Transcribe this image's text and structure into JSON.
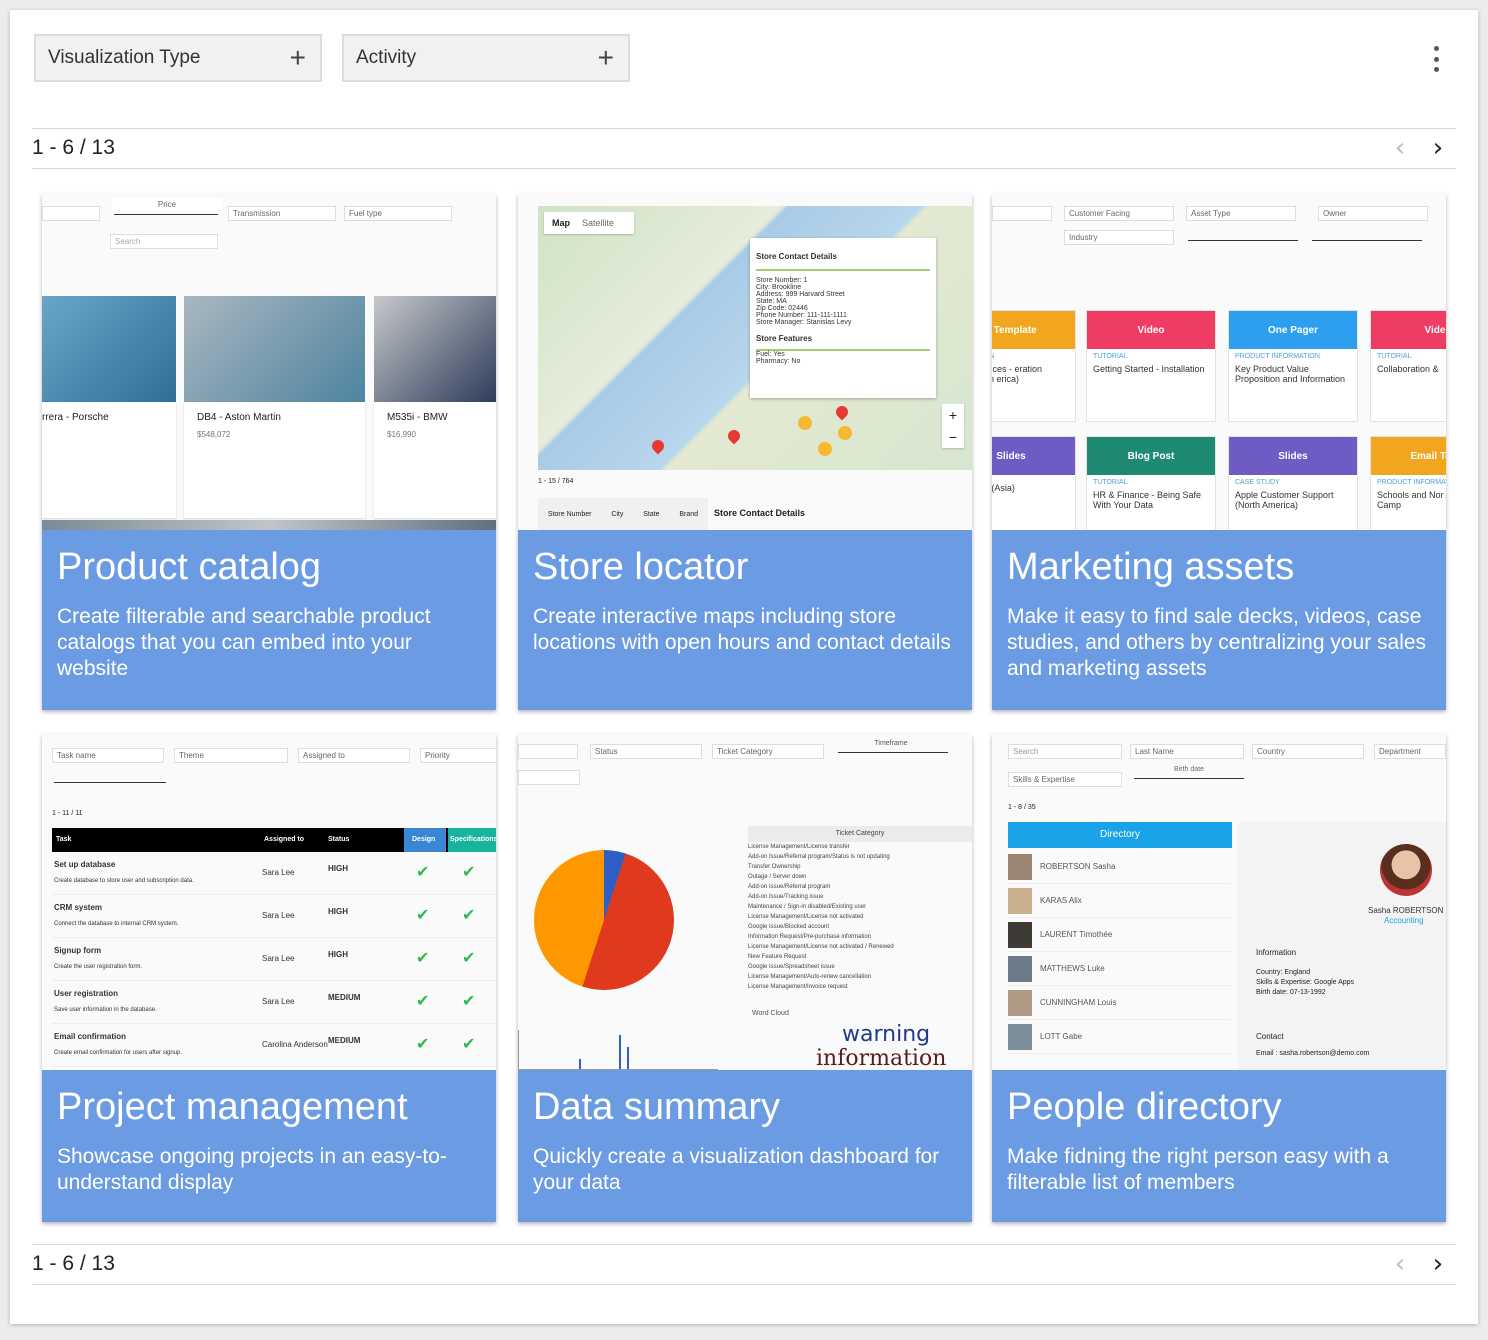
{
  "filters": [
    {
      "label": "Visualization Type",
      "icon": "plus-icon"
    },
    {
      "label": "Activity",
      "icon": "plus-icon"
    }
  ],
  "pagination": {
    "top": "1 - 6 / 13",
    "bottom": "1 - 6 / 13"
  },
  "cards": [
    {
      "title": "Product catalog",
      "description": "Create filterable and searchable product catalogs that you can embed into your website"
    },
    {
      "title": "Store locator",
      "description": "Create interactive maps including store locations with open hours and contact details"
    },
    {
      "title": "Marketing assets",
      "description": "Make it easy to find sale decks, videos, case studies, and others by centralizing your sales and marketing assets"
    },
    {
      "title": "Project management",
      "description": "Showcase ongoing projects in an easy-to-understand display"
    },
    {
      "title": "Data summary",
      "description": "Quickly create a visualization dashboard for your data"
    },
    {
      "title": "People directory",
      "description": "Make fidning the right person easy with a filterable list of members"
    }
  ],
  "thumbs": {
    "product": {
      "filters": [
        "Price",
        "Transmission",
        "Fuel type",
        "Search"
      ],
      "items": [
        {
          "name": "rrera - Porsche",
          "price": ""
        },
        {
          "name": "DB4 - Aston Martin",
          "price": "$548,072"
        },
        {
          "name": "M535i - BMW",
          "price": "$16,990"
        }
      ]
    },
    "store": {
      "tabs": [
        "Map",
        "Satellite"
      ],
      "popup_title": "Store Contact Details",
      "popup_lines": [
        "Store Number: 1",
        "City: Brookline",
        "Address: 999 Harvard Street",
        "State: MA",
        "Zip Code: 02446",
        "Phone Number: 111-111-1111",
        "Store Manager: Stanislas Levy"
      ],
      "features_title": "Store Features",
      "features": [
        "Fuel: Yes",
        "Pharmacy: No"
      ],
      "count": "1 - 15 / 764",
      "table_headers": [
        "Store Number",
        "City",
        "State",
        "Brand"
      ],
      "side_title": "Store Contact Details"
    },
    "marketing": {
      "filters": [
        "Customer Facing",
        "Asset Type",
        "Owner",
        "Industry"
      ],
      "tiles": [
        {
          "head": "il Template",
          "label": "FORMATION",
          "text": "Life Sciences - eration Campaign erica)",
          "color": "#f2a61f"
        },
        {
          "head": "Video",
          "label": "TUTORIAL",
          "text": "Getting Started - Installation",
          "color": "#ef3c63"
        },
        {
          "head": "One Pager",
          "label": "PRODUCT INFORMATION",
          "text": "Key Product Value Proposition and Information",
          "color": "#2c9fee"
        },
        {
          "head": "Vide",
          "label": "TUTORIAL",
          "text": "Collaboration &",
          "color": "#ef3c63"
        },
        {
          "head": "Slides",
          "label": "",
          "text": "les Team (Asia)",
          "color": "#6e5bc4"
        },
        {
          "head": "Blog Post",
          "label": "TUTORIAL",
          "text": "HR & Finance - Being Safe With Your Data",
          "color": "#1f8a73"
        },
        {
          "head": "Slides",
          "label": "CASE STUDY",
          "text": "Apple Customer Support (North America)",
          "color": "#6e5bc4"
        },
        {
          "head": "Email Tem",
          "label": "PRODUCT INFORMAT",
          "text": "Schools and Nor Awareness Camp",
          "color": "#f2a61f"
        }
      ]
    },
    "project": {
      "filters": [
        "Task name",
        "Theme",
        "Assigned to",
        "Priority"
      ],
      "count": "1 - 11 / 11",
      "headers": [
        "Task",
        "Assigned to",
        "Status",
        "Design",
        "Specifications"
      ],
      "rows": [
        {
          "task": "Set up database",
          "desc": "Create database to store user and subscription data.",
          "who": "Sara Lee",
          "status": "HIGH"
        },
        {
          "task": "CRM system",
          "desc": "Connect the database to internal CRM system.",
          "who": "Sara Lee",
          "status": "HIGH"
        },
        {
          "task": "Signup form",
          "desc": "Create the user registration form.",
          "who": "Sara Lee",
          "status": "HIGH"
        },
        {
          "task": "User registration",
          "desc": "Save user information in the database.",
          "who": "Sara Lee",
          "status": "MEDIUM"
        },
        {
          "task": "Email confirmation",
          "desc": "Create email confirmation for users after signup.",
          "who": "Carolina Anderson",
          "status": "MEDIUM"
        }
      ]
    },
    "data": {
      "filters": [
        "Status",
        "Ticket Category",
        "Timeframe"
      ],
      "legend_title": "Ticket Category",
      "legend": [
        "License Management/License transfer",
        "Add-on Issue/Referral program/Status is not updating",
        "Transfer Ownership",
        "Outage / Server down",
        "Add-on Issue/Referral program",
        "Add-on Issue/Tracking issue",
        "Maintenance / Sign-in disabled/Existing user",
        "License Management/License not activated",
        "Google Issue/Blocked account",
        "Information Request/Pre-purchase information",
        "License Management/License not activated / Renewed",
        "New Feature Request",
        "Google Issue/Spreadsheet issue",
        "License Management/Auto-renew cancellation",
        "License Management/Invoice request"
      ],
      "word_cloud": "Word Cloud",
      "words": [
        "warning",
        "information"
      ]
    },
    "people": {
      "filters": [
        "Search",
        "Last Name",
        "Country",
        "Department",
        "Skills & Expertise",
        "Birth date"
      ],
      "count": "1 - 8 / 35",
      "header": "Directory",
      "people": [
        "ROBERTSON Sasha",
        "KARAS Alix",
        "LAURENT Timothée",
        "MATTHEWS Luke",
        "CUNNINGHAM Louis",
        "LOTT Gabe"
      ],
      "profile_name": "Sasha ROBERTSON",
      "profile_dept": "Accounting",
      "info_title": "Information",
      "info": [
        "Country: England",
        "Skills & Expertise: Google Apps",
        "Birth date: 07-13-1992"
      ],
      "contact_title": "Contact",
      "contact": "Email : sasha.robertson@demo.com"
    }
  }
}
